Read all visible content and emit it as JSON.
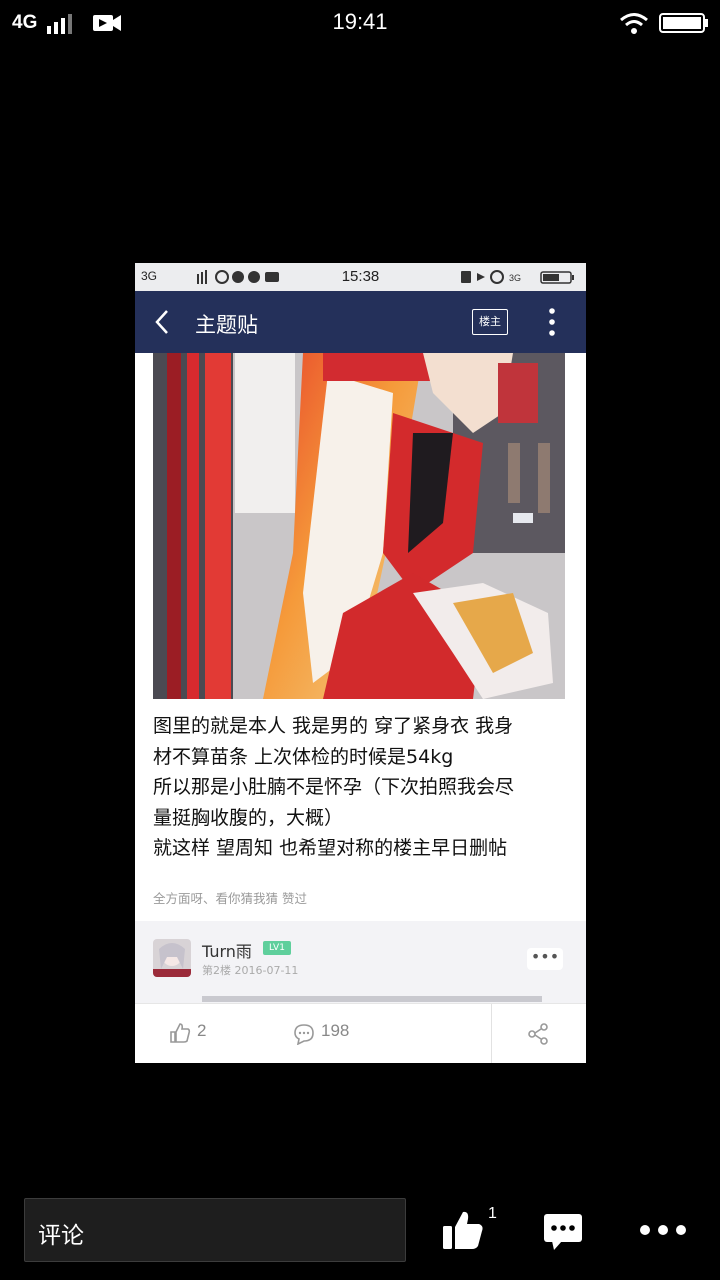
{
  "status_bar": {
    "network": "4G",
    "time": "19:41"
  },
  "inner_screenshot": {
    "status_bar": {
      "network": "3G",
      "time": "15:38"
    },
    "nav": {
      "title": "主题贴",
      "owner_badge": "楼主"
    },
    "post_lines": [
      "图里的就是本人 我是男的 穿了紧身衣 我身",
      "材不算苗条 上次体检的时候是54kg",
      "所以那是小肚腩不是怀孕（下次拍照我会尽",
      "量挺胸收腹的，大概）",
      "就这样 望周知 也希望对称的楼主早日删帖"
    ],
    "tags": "全方面呀、看你猜我猜 赞过",
    "reply": {
      "username": "Turn雨",
      "level_badge": "LV1",
      "meta": "第2楼 2016-07-11"
    },
    "footer": {
      "likes": "2",
      "comments": "198"
    }
  },
  "viewer_bar": {
    "comment_placeholder": "评论",
    "like_count": "1"
  },
  "colors": {
    "nav_bg": "#24305a",
    "level_badge": "#5fcf9c",
    "viewer_bg": "#000000"
  }
}
